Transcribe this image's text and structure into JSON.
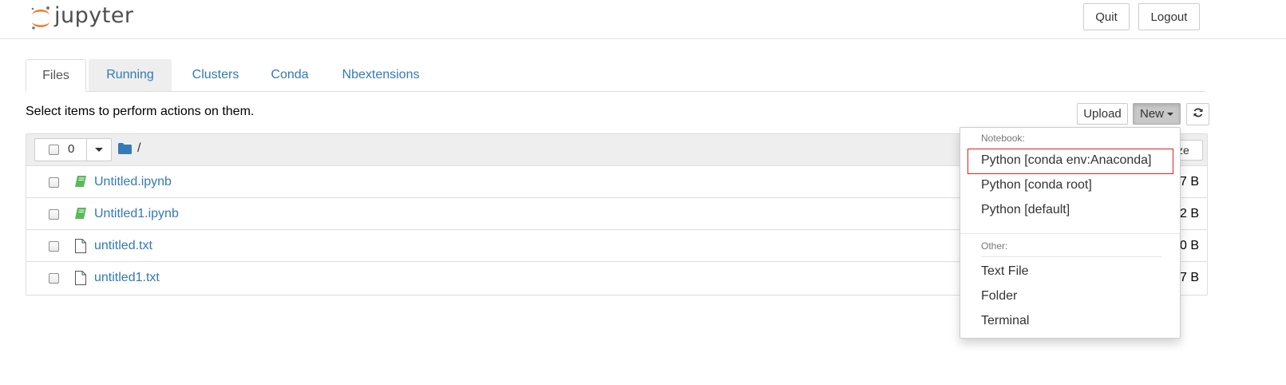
{
  "header": {
    "logo_text": "jupyter",
    "quit_label": "Quit",
    "logout_label": "Logout"
  },
  "tabs": [
    {
      "label": "Files"
    },
    {
      "label": "Running"
    },
    {
      "label": "Clusters"
    },
    {
      "label": "Conda"
    },
    {
      "label": "Nbextensions"
    }
  ],
  "toolbar": {
    "select_message": "Select items to perform actions on them.",
    "upload_label": "Upload",
    "new_label": "New"
  },
  "list_header": {
    "selected_count": "0",
    "path": "/",
    "partial_button_text": "ze"
  },
  "files": [
    {
      "name": "Untitled.ipynb",
      "type": "notebook",
      "size_partial": "7 B"
    },
    {
      "name": "Untitled1.ipynb",
      "type": "notebook",
      "size_partial": "2 B"
    },
    {
      "name": "untitled.txt",
      "type": "file",
      "size_partial": "0 B"
    },
    {
      "name": "untitled1.txt",
      "type": "file",
      "size_partial": "7 B"
    }
  ],
  "new_menu": {
    "notebook_header": "Notebook:",
    "notebook_items": [
      {
        "label": "Python [conda env:Anaconda]",
        "highlighted": true
      },
      {
        "label": "Python [conda root]"
      },
      {
        "label": "Python [default]"
      }
    ],
    "other_header": "Other:",
    "other_items": [
      {
        "label": "Text File"
      },
      {
        "label": "Folder"
      },
      {
        "label": "Terminal"
      }
    ]
  },
  "colors": {
    "link": "#337ab7",
    "logo_orange": "#f37726",
    "notebook_icon": "#5cb85c",
    "folder_icon": "#337ab7",
    "highlight_border": "#e02020"
  }
}
